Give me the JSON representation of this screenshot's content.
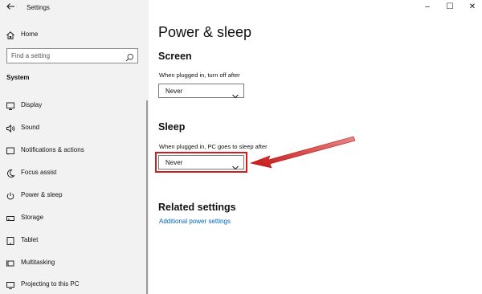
{
  "window": {
    "title": "Settings",
    "controls": {
      "minimize": "–",
      "maximize": "☐",
      "close": "✕"
    }
  },
  "sidebar": {
    "home_label": "Home",
    "search_placeholder": "Find a setting",
    "section_label": "System",
    "items": [
      {
        "label": "Display",
        "icon": "monitor-icon"
      },
      {
        "label": "Sound",
        "icon": "speaker-icon"
      },
      {
        "label": "Notifications & actions",
        "icon": "notification-icon"
      },
      {
        "label": "Focus assist",
        "icon": "moon-icon"
      },
      {
        "label": "Power & sleep",
        "icon": "power-icon"
      },
      {
        "label": "Storage",
        "icon": "storage-icon"
      },
      {
        "label": "Tablet",
        "icon": "tablet-icon"
      },
      {
        "label": "Multitasking",
        "icon": "multitasking-icon"
      },
      {
        "label": "Projecting to this PC",
        "icon": "projector-icon"
      }
    ]
  },
  "main": {
    "page_title": "Power & sleep",
    "screen": {
      "heading": "Screen",
      "label": "When plugged in, turn off after",
      "value": "Never"
    },
    "sleep": {
      "heading": "Sleep",
      "label": "When plugged in, PC goes to sleep after",
      "value": "Never"
    },
    "related": {
      "heading": "Related settings",
      "link": "Additional power settings"
    }
  },
  "colors": {
    "sidebar_bg": "#f2f2f2",
    "link": "#0067b8",
    "annotation": "#cc1f1f"
  }
}
